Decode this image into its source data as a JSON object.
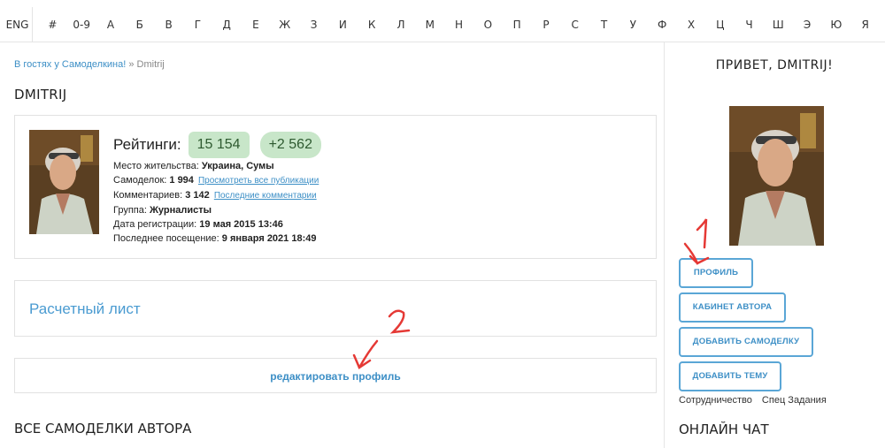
{
  "alphabet": {
    "eng": "ENG",
    "letters": [
      "#",
      "0-9",
      "А",
      "Б",
      "В",
      "Г",
      "Д",
      "Е",
      "Ж",
      "З",
      "И",
      "К",
      "Л",
      "М",
      "Н",
      "О",
      "П",
      "Р",
      "С",
      "Т",
      "У",
      "Ф",
      "Х",
      "Ц",
      "Ч",
      "Ш",
      "Э",
      "Ю",
      "Я"
    ]
  },
  "breadcrumb": {
    "home": "В гостях у Самоделкина!",
    "separator": " » ",
    "current": "Dmitrij"
  },
  "page_title": "DMITRIJ",
  "profile": {
    "ratings_label": "Рейтинги:",
    "rating": "15 154",
    "rating_delta": "+2 562",
    "residence_label": "Место жительства:",
    "residence": "Украина, Сумы",
    "works_label": "Самоделок:",
    "works": "1 994",
    "works_link": "Просмотреть все публикации",
    "comments_label": "Комментариев:",
    "comments": "3 142",
    "comments_link": "Последние комментарии",
    "group_label": "Группа:",
    "group": "Журналисты",
    "registered_label": "Дата регистрации:",
    "registered": "19 мая 2015 13:46",
    "last_visit_label": "Последнее посещение:",
    "last_visit": "9 января 2021 18:49"
  },
  "calc_sheet": "Расчетный лист",
  "edit_profile": "редактировать профиль",
  "all_works_title": "ВСЕ САМОДЕЛКИ АВТОРА",
  "sidebar": {
    "greeting": "ПРИВЕТ, DMITRIJ!",
    "btn_profile": "ПРОФИЛЬ",
    "btn_cabinet": "КАБИНЕТ АВТОРА",
    "btn_add_work": "ДОБАВИТЬ САМОДЕЛКУ",
    "btn_add_topic": "ДОБАВИТЬ ТЕМУ",
    "link_cooperation": "Сотрудничество",
    "link_special": "Спец Задания",
    "chat_title": "ОНЛАЙН ЧАТ"
  },
  "annotations": {
    "one": "1",
    "two": "2"
  },
  "colors": {
    "link": "#3d8fc6",
    "button_border": "#5aa6d6",
    "pill_bg": "#c8e6c9",
    "annotation": "#e53935"
  }
}
